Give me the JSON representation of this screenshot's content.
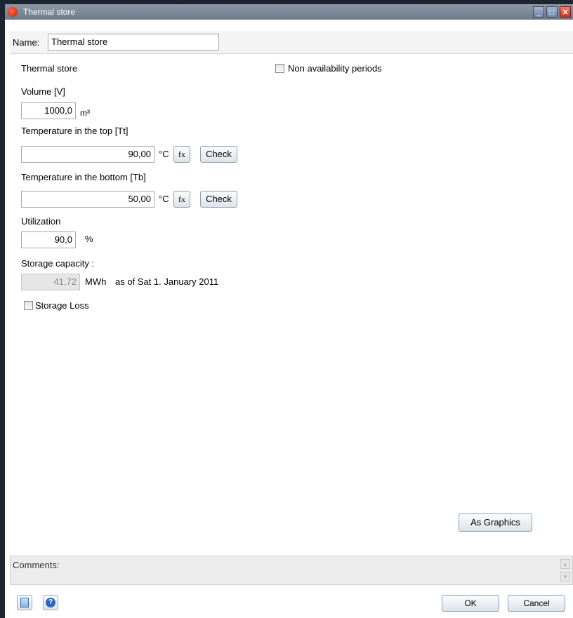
{
  "window": {
    "title": "Thermal store"
  },
  "name_field": {
    "label": "Name:",
    "value": "Thermal store"
  },
  "section_title": "Thermal store",
  "non_availability": {
    "label": "Non availability periods",
    "checked": false
  },
  "volume": {
    "label": "Volume [V]",
    "value": "1000,0",
    "unit": "m³"
  },
  "temp_top": {
    "label": "Temperature in the top [Tt]",
    "value": "90,00",
    "unit": "°C",
    "fx_label": "fx",
    "check_label": "Check"
  },
  "temp_bottom": {
    "label": "Temperature in the bottom [Tb]",
    "value": "50,00",
    "unit": "°C",
    "fx_label": "fx",
    "check_label": "Check"
  },
  "utilization": {
    "label": "Utilization",
    "value": "90,0",
    "unit": "%"
  },
  "storage_capacity": {
    "label": "Storage capacity :",
    "value": "41,72",
    "unit": "MWh",
    "as_of": "as of Sat 1. January 2011"
  },
  "storage_loss": {
    "label": "Storage Loss",
    "checked": false
  },
  "as_graphics_label": "As Graphics",
  "comments": {
    "label": "Comments:"
  },
  "footer": {
    "ok_label": "OK",
    "cancel_label": "Cancel"
  },
  "icons": {
    "app": "app-logo-icon",
    "copy": "copy-document-icon",
    "help": "help-icon"
  }
}
